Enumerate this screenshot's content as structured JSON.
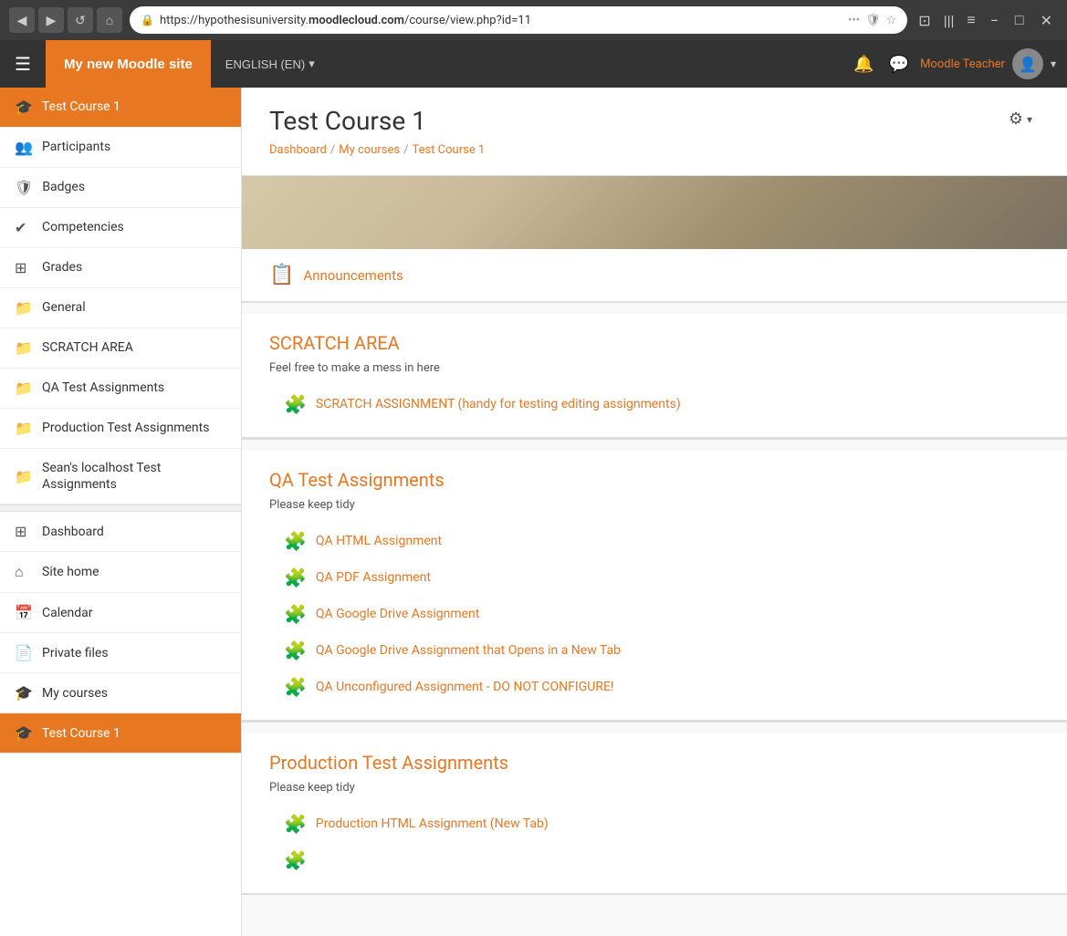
{
  "browser": {
    "back_btn": "◀",
    "forward_btn": "▶",
    "reload_btn": "↺",
    "home_btn": "⌂",
    "url": "https://hypothesisuniversity.moodlecloud.com/course/view.php?id=11",
    "url_domain": "moodlecloud.com",
    "more_btn": "•••",
    "shield_icon": "🛡",
    "star_icon": "☆",
    "screen_icon": "⊡",
    "bars_icon": "|||",
    "menu_icon": "≡",
    "minimize_icon": "−",
    "maximize_icon": "□",
    "close_icon": "✕"
  },
  "topnav": {
    "hamburger": "☰",
    "site_name": "My new Moodle site",
    "language": "ENGLISH (EN)",
    "lang_chevron": "▾",
    "notification_icon": "🔔",
    "message_icon": "💬",
    "teacher_name": "Moodle Teacher",
    "avatar_icon": "👤",
    "avatar_chevron": "▾"
  },
  "sidebar": {
    "items": [
      {
        "id": "test-course-1-top",
        "icon": "🎓",
        "label": "Test Course 1",
        "active": true
      },
      {
        "id": "participants",
        "icon": "👥",
        "label": "Participants",
        "active": false
      },
      {
        "id": "badges",
        "icon": "🛡",
        "label": "Badges",
        "active": false
      },
      {
        "id": "competencies",
        "icon": "✓",
        "label": "Competencies",
        "active": false
      },
      {
        "id": "grades",
        "icon": "⊞",
        "label": "Grades",
        "active": false
      },
      {
        "id": "general",
        "icon": "📄",
        "label": "General",
        "active": false
      },
      {
        "id": "scratch-area",
        "icon": "📄",
        "label": "SCRATCH AREA",
        "active": false
      },
      {
        "id": "qa-test-assignments",
        "icon": "📄",
        "label": "QA Test Assignments",
        "active": false
      },
      {
        "id": "production-test-assignments",
        "icon": "📄",
        "label": "Production Test Assignments",
        "active": false
      },
      {
        "id": "seans-localhost",
        "icon": "📄",
        "label": "Sean's localhost Test Assignments",
        "active": false
      }
    ],
    "bottom_items": [
      {
        "id": "dashboard",
        "icon": "⊞",
        "label": "Dashboard"
      },
      {
        "id": "site-home",
        "icon": "⌂",
        "label": "Site home"
      },
      {
        "id": "calendar",
        "icon": "📅",
        "label": "Calendar"
      },
      {
        "id": "private-files",
        "icon": "📄",
        "label": "Private files"
      },
      {
        "id": "my-courses",
        "icon": "🎓",
        "label": "My courses"
      },
      {
        "id": "test-course-1-bottom",
        "icon": "🎓",
        "label": "Test Course 1",
        "active": true
      }
    ]
  },
  "course": {
    "title": "Test Course 1",
    "breadcrumb": {
      "dashboard": "Dashboard",
      "sep1": "/",
      "my_courses": "My courses",
      "sep2": "/",
      "current": "Test Course 1"
    },
    "gear_icon": "⚙",
    "sections": {
      "announcements": {
        "icon": "📋",
        "link": "Announcements"
      },
      "scratch_area": {
        "title": "SCRATCH AREA",
        "subtitle": "Feel free to make a mess in here",
        "activities": [
          {
            "icon": "🧩",
            "label": "SCRATCH ASSIGNMENT (handy for testing editing assignments)"
          }
        ]
      },
      "qa_test_assignments": {
        "title": "QA Test Assignments",
        "subtitle": "Please keep tidy",
        "activities": [
          {
            "icon": "🧩",
            "label": "QA HTML Assignment"
          },
          {
            "icon": "🧩",
            "label": "QA PDF Assignment"
          },
          {
            "icon": "🧩",
            "label": "QA Google Drive Assignment"
          },
          {
            "icon": "🧩",
            "label": "QA Google Drive Assignment that Opens in a New Tab"
          },
          {
            "icon": "🧩",
            "label": "QA Unconfigured Assignment - DO NOT CONFIGURE!"
          }
        ]
      },
      "production_test_assignments": {
        "title": "Production Test Assignments",
        "subtitle": "Please keep tidy",
        "activities": [
          {
            "icon": "🧩",
            "label": "Production HTML Assignment (New Tab)"
          }
        ]
      }
    }
  }
}
